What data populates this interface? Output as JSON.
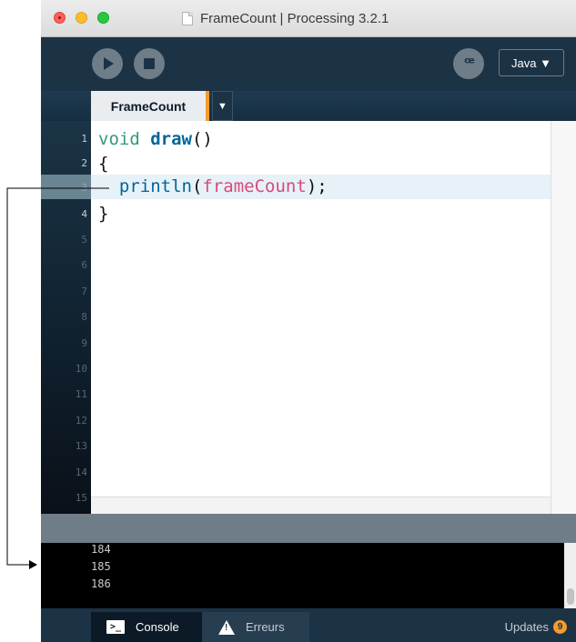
{
  "window": {
    "title": "FrameCount | Processing 3.2.1"
  },
  "toolbar": {
    "run_icon": "play-icon",
    "stop_icon": "stop-icon",
    "debug_icon": "debugger-icon",
    "debug_glyph": "ꟹ",
    "mode_label": "Java ▼"
  },
  "tabs": {
    "active_label": "FrameCount",
    "menu_glyph": "▼"
  },
  "editor": {
    "line_numbers": [
      "1",
      "2",
      "3",
      "4",
      "5",
      "6",
      "7",
      "8",
      "9",
      "10",
      "11",
      "12",
      "13",
      "14",
      "15"
    ],
    "code": {
      "line1_kw": "void",
      "line1_fn": "draw",
      "line1_rest": "()",
      "line2": "{",
      "line3_indent": "  ",
      "line3_fn": "println",
      "line3_open": "(",
      "line3_var": "frameCount",
      "line3_close": ");",
      "line4": "}"
    }
  },
  "console": {
    "lines": [
      "184",
      "185",
      "186"
    ]
  },
  "statusbar": {
    "console_label": "Console",
    "console_icon_glyph": ">_",
    "errors_label": "Erreurs",
    "updates_label": "Updates",
    "updates_count": "9"
  },
  "colors": {
    "toolbar_bg": "#1c3346",
    "accent_orange": "#f39b2e",
    "keyword": "#33997e",
    "function": "#006699",
    "variable": "#d94a7a"
  }
}
